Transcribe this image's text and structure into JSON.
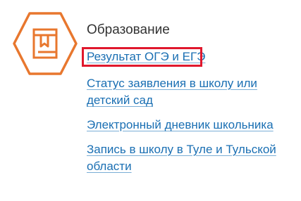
{
  "section": {
    "title": "Образование",
    "icon": "book-hexagon-icon",
    "accent_color": "#e8772e",
    "highlight_color": "#e0182d",
    "link_color": "#1a6fb3",
    "links": [
      {
        "label": "Результат ОГЭ и ЕГЭ",
        "highlighted": true
      },
      {
        "label": "Статус заявления в школу или детский сад"
      },
      {
        "label": "Электронный дневник школьника"
      },
      {
        "label": "Запись в школу в Туле и Тульской области"
      }
    ]
  }
}
